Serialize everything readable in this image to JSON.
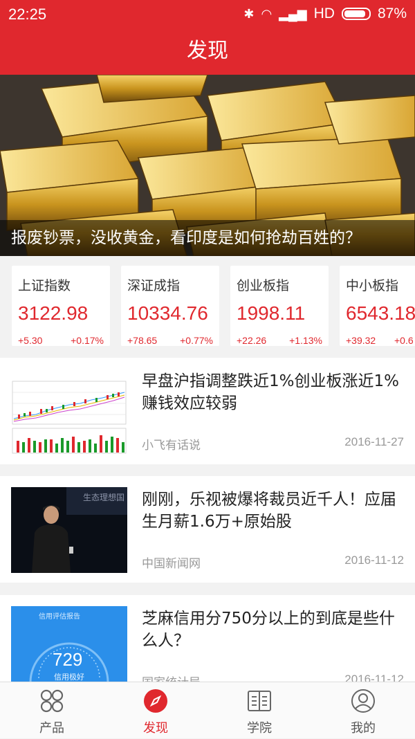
{
  "status_bar": {
    "time": "22:25",
    "network": "HD",
    "battery": "87%"
  },
  "nav": {
    "title": "发现"
  },
  "banner": {
    "caption": "报废钞票，没收黄金，看印度是如何抢劫百姓的？"
  },
  "indices": [
    {
      "name": "上证指数",
      "value": "3122.98",
      "change": "+5.30",
      "percent": "+0.17%"
    },
    {
      "name": "深证成指",
      "value": "10334.76",
      "change": "+78.65",
      "percent": "+0.77%"
    },
    {
      "name": "创业板指",
      "value": "1998.11",
      "change": "+22.26",
      "percent": "+1.13%"
    },
    {
      "name": "中小板指",
      "value": "6543.18",
      "change": "+39.32",
      "percent": "+0.6"
    }
  ],
  "articles": [
    {
      "title": "早盘沪指调整跌近1%创业板涨近1% 赚钱效应较弱",
      "source": "小飞有话说",
      "date": "2016-11-27",
      "thumb_type": "stock-chart"
    },
    {
      "title": "刚刚，乐视被爆将裁员近千人！应届生月薪1.6万+原始股",
      "source": "中国新闻网",
      "date": "2016-11-12",
      "thumb_type": "stage-speaker",
      "thumb_text": "生态理想国"
    },
    {
      "title": "芝麻信用分750分以上的到底是些什么人？",
      "source": "国家统计局",
      "date": "2016-11-12",
      "thumb_type": "credit-score",
      "thumb_header": "信用评估报告",
      "thumb_score": "729",
      "thumb_level": "信用极好"
    }
  ],
  "tabs": [
    {
      "label": "产品",
      "icon": "grid-icon"
    },
    {
      "label": "发现",
      "icon": "compass-icon",
      "active": true
    },
    {
      "label": "学院",
      "icon": "book-icon"
    },
    {
      "label": "我的",
      "icon": "user-icon"
    }
  ],
  "colors": {
    "brand": "#e0282e",
    "up": "#e0282e",
    "chart_green": "#1a9a2a"
  }
}
